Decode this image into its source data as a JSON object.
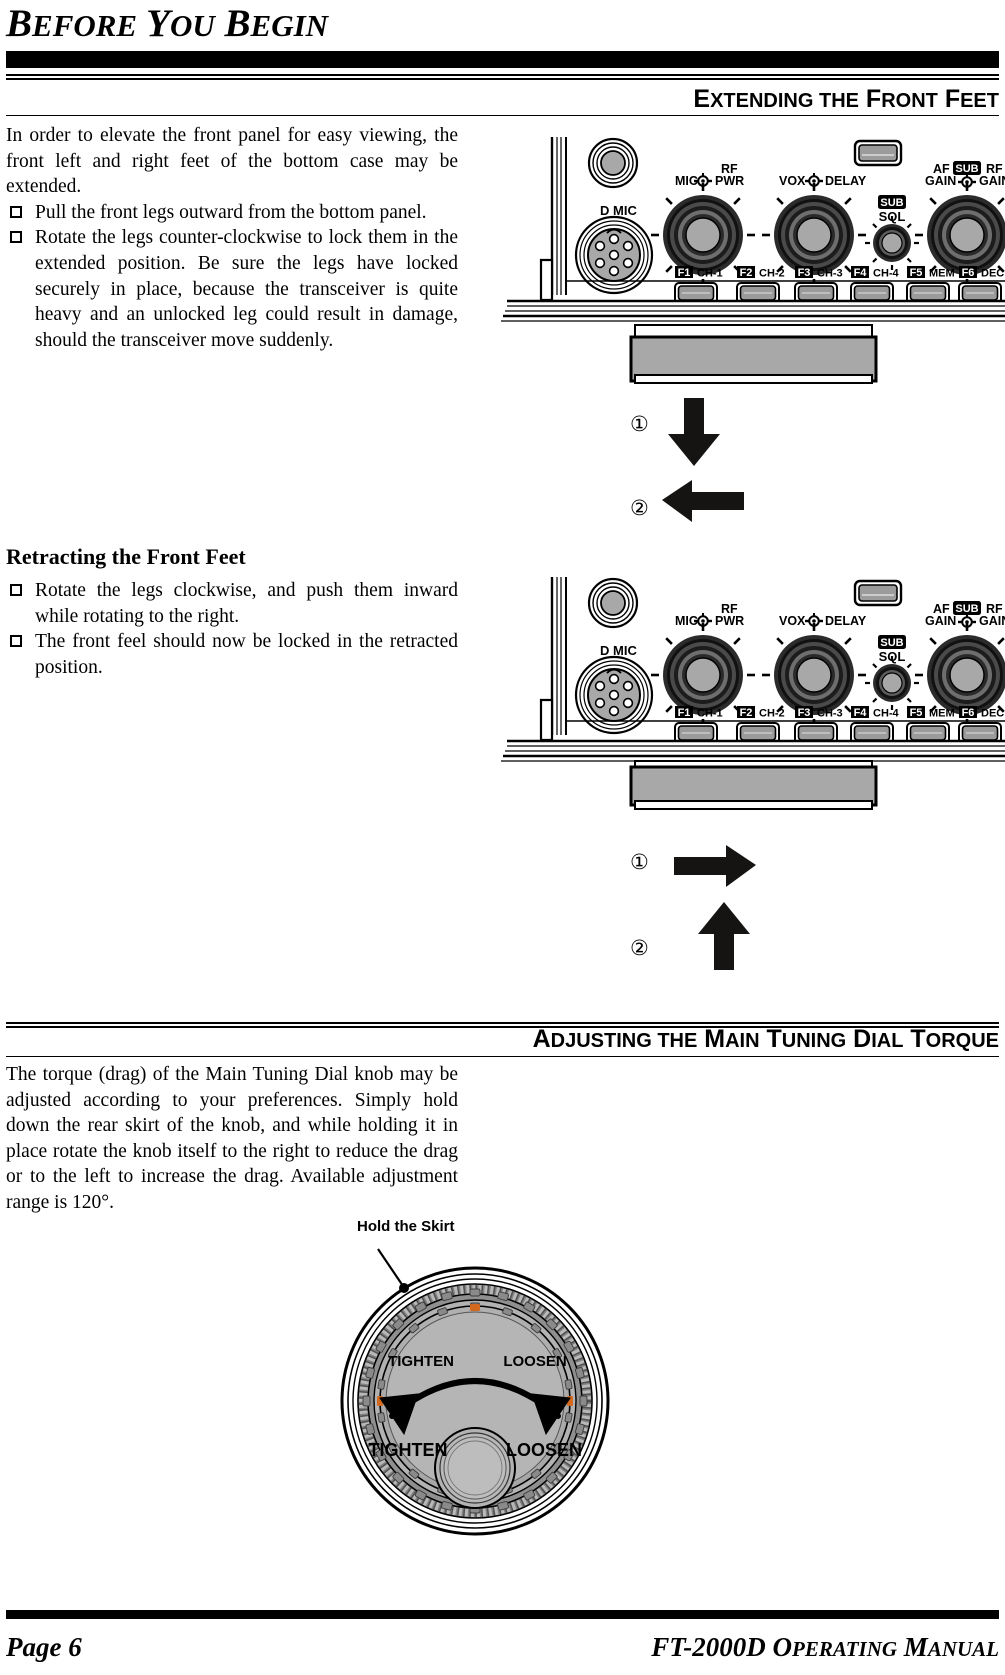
{
  "page": {
    "title_parts": [
      {
        "t": "B",
        "size": "big"
      },
      {
        "t": "EFORE",
        "size": "small"
      },
      {
        "t": " Y",
        "size": "big"
      },
      {
        "t": "OU",
        "size": "small"
      },
      {
        "t": " B",
        "size": "big"
      },
      {
        "t": "EGIN",
        "size": "small"
      }
    ],
    "title_plain": "BEFORE YOU BEGIN"
  },
  "sections": [
    {
      "id": "extending-front-feet",
      "heading_plain": "EXTENDING THE FRONT FEET",
      "heading_parts": [
        {
          "t": "E",
          "size": "cap"
        },
        {
          "t": "XTENDING",
          "size": "sm"
        },
        {
          "t": " ",
          "size": "sm"
        },
        {
          "t": "THE",
          "size": "sm"
        },
        {
          "t": " F",
          "size": "cap"
        },
        {
          "t": "RONT",
          "size": "sm"
        },
        {
          "t": " F",
          "size": "cap"
        },
        {
          "t": "EET",
          "size": "sm"
        }
      ],
      "intro": "In order to elevate the front panel for easy viewing, the front left and right feet of the bottom case may be extended.",
      "bullets": [
        "Pull the front legs outward from the bottom panel.",
        "Rotate the legs counter-clockwise to lock them in the extended position. Be sure the legs have locked securely in place, because the transceiver is quite heavy and an unlocked leg could result in damage, should the transceiver move suddenly."
      ],
      "subsection": {
        "heading": "Retracting the Front Feet",
        "bullets": [
          "Rotate the legs clockwise, and push them inward while rotating to the right.",
          "The front feel should now be locked in the retracted position."
        ]
      }
    },
    {
      "id": "adjusting-main-tuning-dial-torque",
      "heading_plain": "ADJUSTING THE MAIN TUNING DIAL TORQUE",
      "heading_parts": [
        {
          "t": "A",
          "size": "cap"
        },
        {
          "t": "DJUSTING",
          "size": "sm"
        },
        {
          "t": " ",
          "size": "sm"
        },
        {
          "t": "THE",
          "size": "sm"
        },
        {
          "t": " M",
          "size": "cap"
        },
        {
          "t": "AIN",
          "size": "sm"
        },
        {
          "t": " T",
          "size": "cap"
        },
        {
          "t": "UNING",
          "size": "sm"
        },
        {
          "t": " D",
          "size": "cap"
        },
        {
          "t": "IAL",
          "size": "sm"
        },
        {
          "t": " T",
          "size": "cap"
        },
        {
          "t": "ORQUE",
          "size": "sm"
        }
      ],
      "intro": "The torque (drag) of the Main Tuning Dial knob may be adjusted according to your preferences. Simply hold down the rear skirt of the knob, and while holding it in place rotate the knob itself to the right to reduce the drag or to the left to increase the drag. Available adjustment range is 120°."
    }
  ],
  "figures": {
    "panel_extended": {
      "mic_port_label": "MIC",
      "mic_port_prefix": "D",
      "knobs": [
        {
          "left": "MIC",
          "right": "RF PWR",
          "top_left": "MIC",
          "top_right_line1": "RF",
          "top_right_line2": "PWR"
        },
        {
          "left": "VOX",
          "right": "DELAY"
        },
        {
          "badge": "SUB",
          "label": "SQL"
        },
        {
          "left_line1": "AF",
          "left_line2": "GAIN",
          "badge": "SUB",
          "right_line1": "RF",
          "right_line2": "GAIN"
        }
      ],
      "function_buttons": [
        {
          "fkey": "F1",
          "label": "CH-1"
        },
        {
          "fkey": "F2",
          "label": "CH-2"
        },
        {
          "fkey": "F3",
          "label": "CH-3"
        },
        {
          "fkey": "F4",
          "label": "CH-4"
        },
        {
          "fkey": "F5",
          "label": "MEM"
        },
        {
          "fkey": "F6",
          "label": "DEC"
        }
      ],
      "callouts": [
        {
          "number": "①",
          "arrow": "down"
        },
        {
          "number": "②",
          "arrow": "left"
        }
      ]
    },
    "panel_retracted": {
      "callouts": [
        {
          "number": "①",
          "arrow": "right"
        },
        {
          "number": "②",
          "arrow": "up"
        }
      ]
    },
    "tuning_dial": {
      "skirt_label": "Hold the Skirt",
      "tighten_label": "TIGHTEN",
      "loosen_label": "LOOSEN"
    }
  },
  "footer": {
    "left": "Page 6",
    "right_plain": "FT-2000D OPERATING MANUAL",
    "right_parts": [
      {
        "t": "FT-2000D O",
        "size": "cap"
      },
      {
        "t": "PERATING",
        "size": "sm"
      },
      {
        "t": " M",
        "size": "cap"
      },
      {
        "t": "ANUAL",
        "size": "sm"
      }
    ]
  },
  "colors": {
    "ink": "#000000",
    "panel_gray": "#a8a8a8",
    "panel_light": "#d4d4d4",
    "knob_dark": "#3a3a3a",
    "knob_mid": "#7d7d7d"
  }
}
